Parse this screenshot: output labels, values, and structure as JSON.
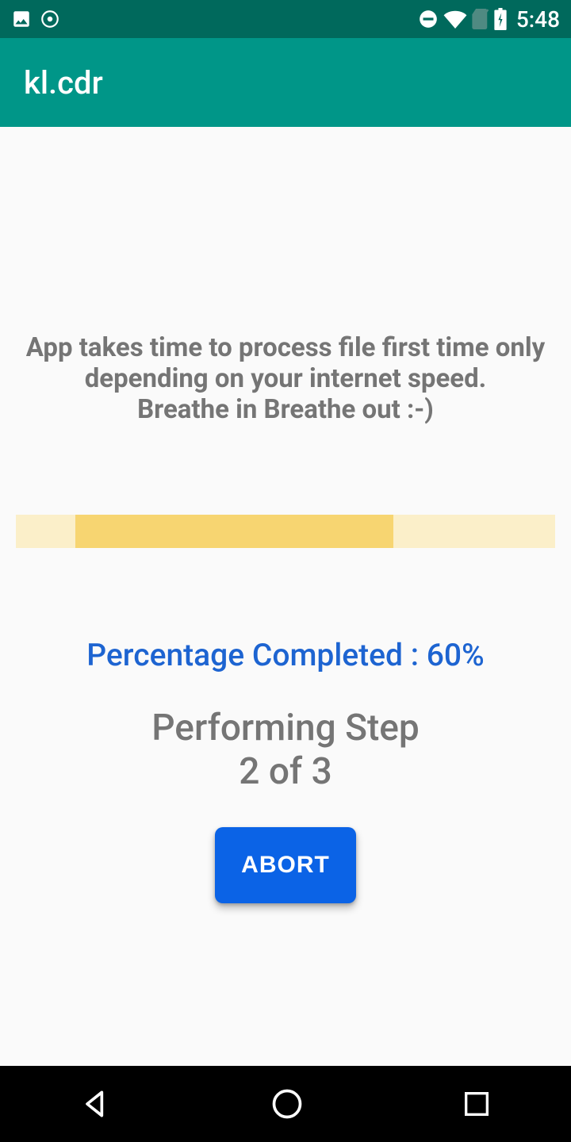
{
  "status_bar": {
    "time": "5:48"
  },
  "app_bar": {
    "title": "kl.cdr"
  },
  "content": {
    "info_line1": "App takes time to process file first time only",
    "info_line2": "depending on your internet speed.",
    "info_line3": "Breathe in Breathe out :-)",
    "percentage_label": "Percentage Completed : 60%",
    "percentage_value": 60,
    "step_line1": "Performing Step",
    "step_line2": "2 of 3",
    "step_current": 2,
    "step_total": 3,
    "abort_label": "ABORT",
    "indeterminate_segment_left_pct": 11,
    "indeterminate_segment_width_pct": 59
  },
  "colors": {
    "status_bar_bg": "#00695c",
    "app_bar_bg": "#009688",
    "accent_blue": "#0b63e6",
    "progress_fill": "#f7d571",
    "progress_track": "#fbefc9"
  }
}
